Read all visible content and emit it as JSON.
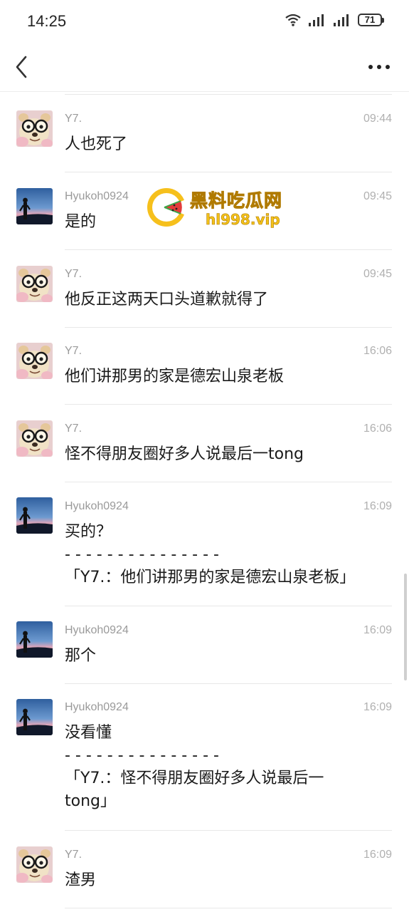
{
  "status_bar": {
    "time": "14:25",
    "battery": "71"
  },
  "top_bar": {
    "back_icon": "chevron-left-icon",
    "more_icon": "more-horizontal-icon"
  },
  "watermark": {
    "title": "黑料吃瓜网",
    "url": "hl998.vip"
  },
  "messages": [
    {
      "sender": "Y7.",
      "time": "09:44",
      "text": "人也死了",
      "avatar": "bear-glasses-avatar"
    },
    {
      "sender": "Hyukoh0924",
      "time": "09:45",
      "text": "是的",
      "avatar": "sunset-silhouette-avatar"
    },
    {
      "sender": "Y7.",
      "time": "09:45",
      "text": "他反正这两天口头道歉就得了",
      "avatar": "bear-glasses-avatar"
    },
    {
      "sender": "Y7.",
      "time": "16:06",
      "text": "他们讲那男的家是德宏山泉老板",
      "avatar": "bear-glasses-avatar"
    },
    {
      "sender": "Y7.",
      "time": "16:06",
      "text": "怪不得朋友圈好多人说最后一tong",
      "avatar": "bear-glasses-avatar"
    },
    {
      "sender": "Hyukoh0924",
      "time": "16:09",
      "text": "买的？\n- - - - - - - - - - - - - - -\n「Y7.：他们讲那男的家是德宏山泉老板」",
      "avatar": "sunset-silhouette-avatar"
    },
    {
      "sender": "Hyukoh0924",
      "time": "16:09",
      "text": "那个",
      "avatar": "sunset-silhouette-avatar"
    },
    {
      "sender": "Hyukoh0924",
      "time": "16:09",
      "text": "没看懂\n- - - - - - - - - - - - - - -\n「Y7.：怪不得朋友圈好多人说最后一\ntong」",
      "avatar": "sunset-silhouette-avatar"
    },
    {
      "sender": "Y7.",
      "time": "16:09",
      "text": "渣男",
      "avatar": "bear-glasses-avatar"
    }
  ]
}
